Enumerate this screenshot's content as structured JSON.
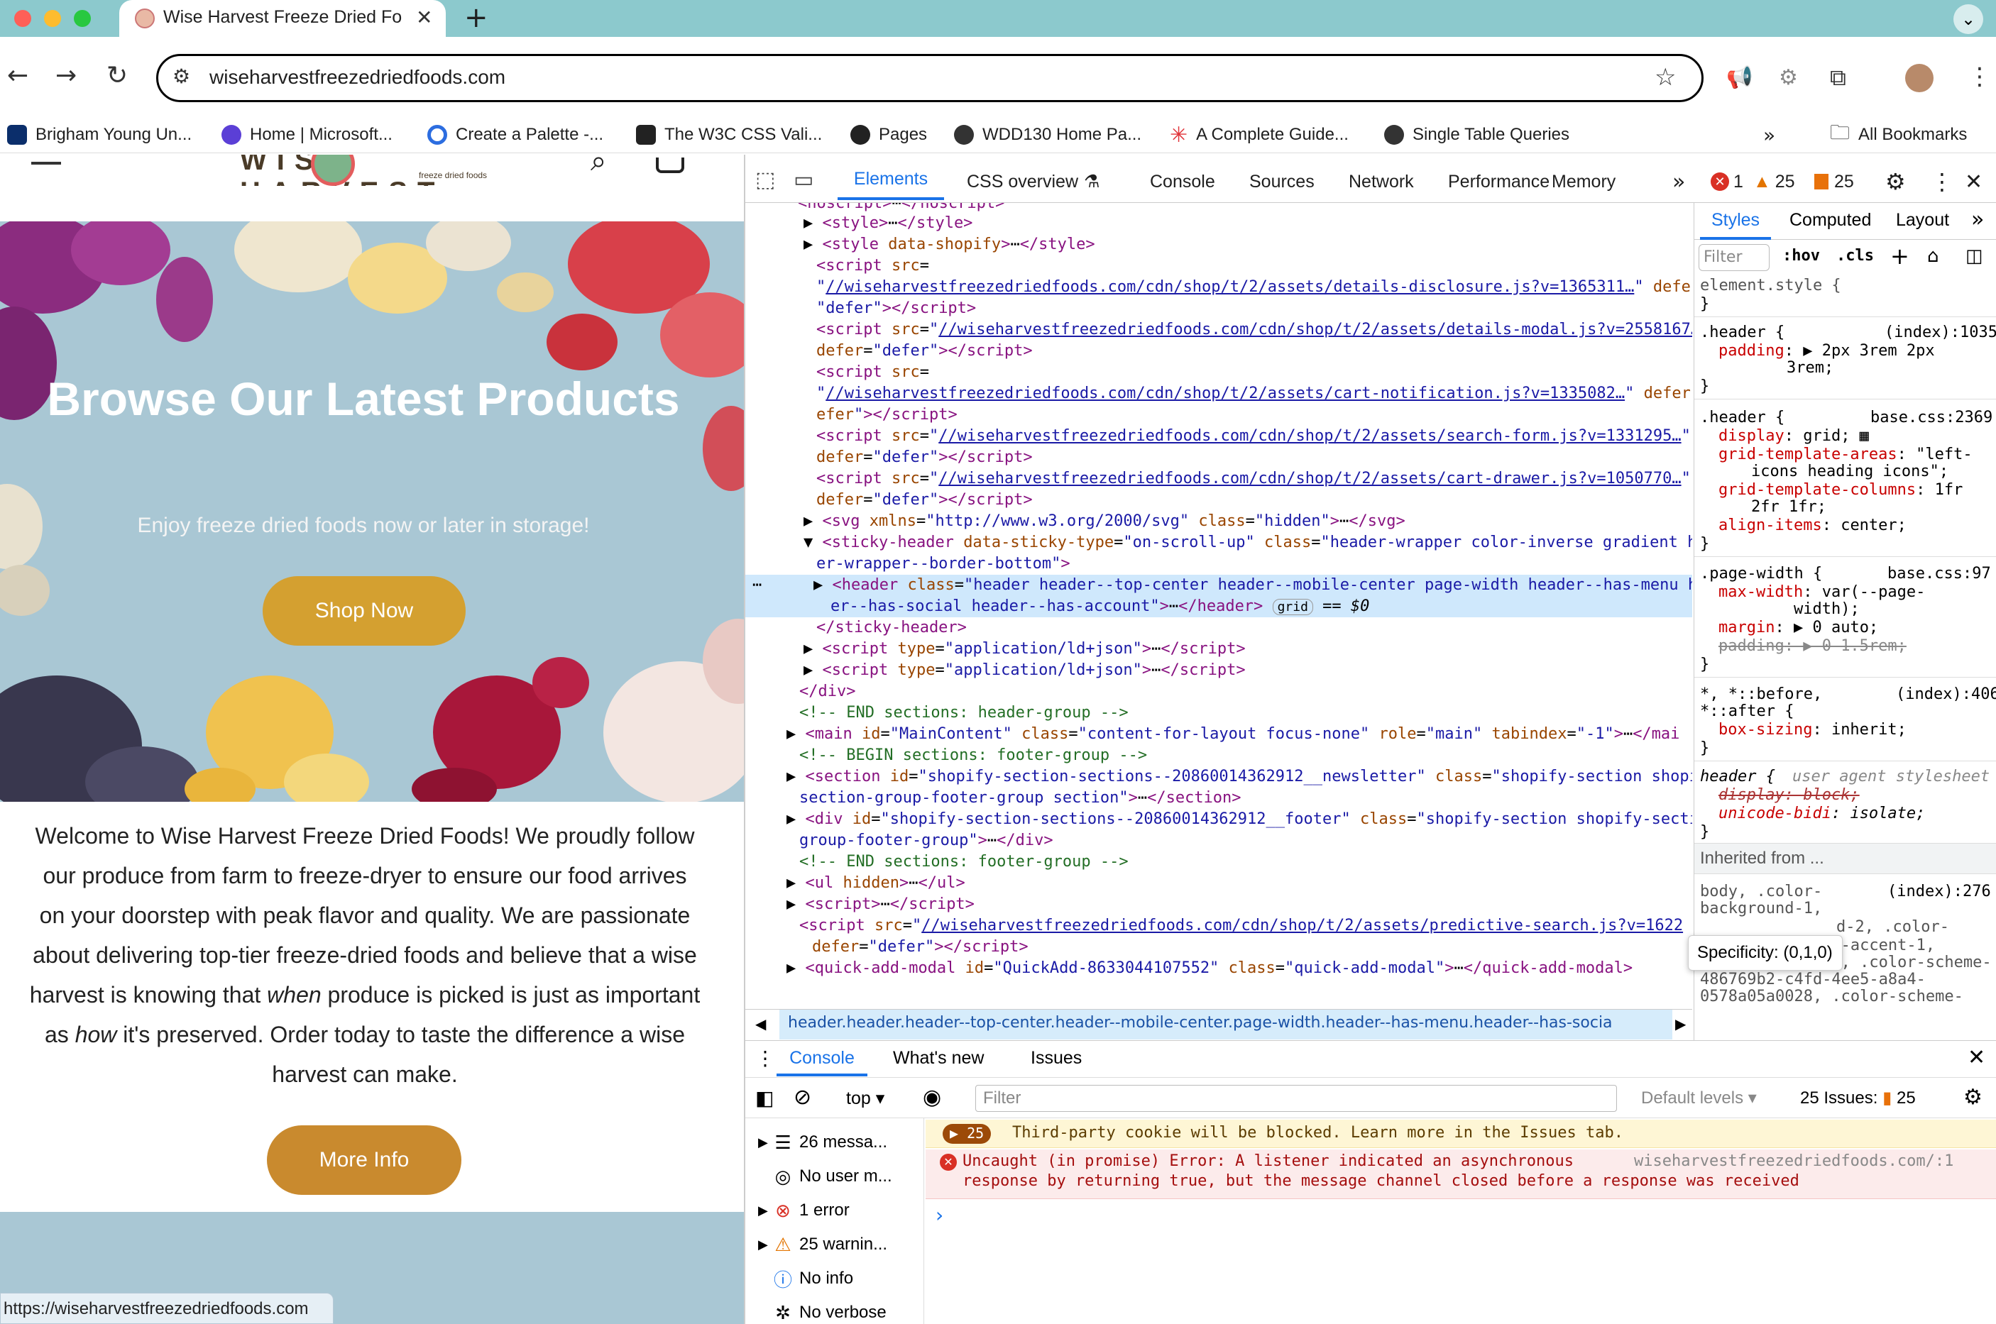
{
  "browser": {
    "tab_title": "Wise Harvest Freeze Dried Fo",
    "url": "wiseharvestfreezedriedfoods.com",
    "bookmarks": [
      {
        "label": "Brigham Young Un...",
        "icon": "byu-icon"
      },
      {
        "label": "Home | Microsoft...",
        "icon": "microsoft-icon"
      },
      {
        "label": "Create a Palette -...",
        "icon": "palette-icon"
      },
      {
        "label": "The W3C CSS Vali...",
        "icon": "w3c-icon"
      },
      {
        "label": "Pages",
        "icon": "github-icon"
      },
      {
        "label": "WDD130 Home Pa...",
        "icon": "globe-icon"
      },
      {
        "label": "A Complete Guide...",
        "icon": "asterisk-icon"
      },
      {
        "label": "Single Table Queries",
        "icon": "globe-icon"
      }
    ],
    "all_bookmarks": "All Bookmarks",
    "status_url": "https://wiseharvestfreezedriedfoods.com"
  },
  "page": {
    "hero_title": "Browse Our Latest Products",
    "hero_subtitle": "Enjoy freeze dried foods now or later in storage!",
    "shop_button": "Shop Now",
    "welcome_part1": "Welcome to Wise Harvest Freeze Dried Foods! We proudly follow our produce from farm to freeze-dryer to ensure our food arrives on your doorstep with peak flavor and quality. We are passionate about delivering top-tier freeze-dried foods and believe that a wise harvest is knowing that ",
    "welcome_em1": "when",
    "welcome_part2": " produce is picked is just as important as ",
    "welcome_em2": "how",
    "welcome_part3": " it's preserved. Order today to taste the difference a wise harvest can make.",
    "more_button": "More Info",
    "logo_text": "WISE HARVEST",
    "logo_sub": "freeze dried foods"
  },
  "devtools": {
    "tabs": [
      "Elements",
      "CSS overview",
      "Console",
      "Sources",
      "Network",
      "Performance",
      "Memory"
    ],
    "errors": "1",
    "warnings": "25",
    "issues": "25",
    "breadcrumb": "header.header.header--top-center.header--mobile-center.page-width.header--has-menu.header--has-socia",
    "styles_tabs": [
      "Styles",
      "Computed",
      "Layout"
    ],
    "filter_placeholder": "Filter",
    "hov": ":hov",
    "cls": ".cls",
    "specificity_tooltip": "Specificity: (0,1,0)",
    "inherited": "Inherited from ...",
    "console_tabs": [
      "Console",
      "What's new",
      "Issues"
    ],
    "console_context": "top",
    "console_filter": "Filter",
    "default_levels": "Default levels",
    "issues_label": "25 Issues:",
    "issues_count": "25",
    "sidebar": [
      {
        "label": "26 messa...",
        "icon": "list-icon"
      },
      {
        "label": "No user m...",
        "icon": "user-icon"
      },
      {
        "label": "1 error",
        "icon": "error-icon"
      },
      {
        "label": "25 warnin...",
        "icon": "warning-icon"
      },
      {
        "label": "No info",
        "icon": "info-icon"
      },
      {
        "label": "No verbose",
        "icon": "bug-icon"
      }
    ],
    "msg_warning_count": "25",
    "msg_warning": "Third-party cookie will be blocked. Learn more in the Issues tab.",
    "msg_error_line1": "Uncaught (in promise) Error: A listener indicated an asynchronous",
    "msg_error_line2": "response by returning true, but the message channel closed before a response was received",
    "msg_error_source": "wiseharvestfreezedriedfoods.com/:1"
  }
}
